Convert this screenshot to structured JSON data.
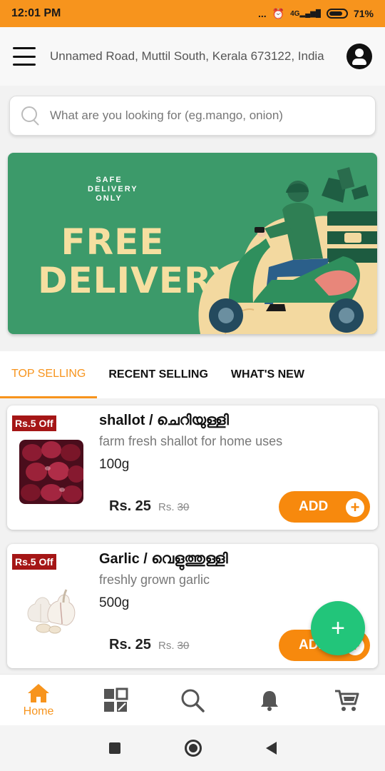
{
  "status_bar": {
    "time": "12:01 PM",
    "dots": "...",
    "network": "4G",
    "battery": "71%"
  },
  "header": {
    "address": "Unnamed Road, Muttil South, Kerala 673122, India"
  },
  "search": {
    "placeholder": "What are you looking for (eg.mango, onion)"
  },
  "banner": {
    "tagline_1": "SAFE",
    "tagline_2": "DELIVERY",
    "tagline_3": "ONLY",
    "headline_1": "FREE",
    "headline_2": "DELIVERY"
  },
  "tabs": [
    {
      "label": "TOP SELLING",
      "active": true
    },
    {
      "label": "RECENT SELLING",
      "active": false
    },
    {
      "label": "WHAT'S NEW",
      "active": false
    }
  ],
  "products": [
    {
      "badge": "Rs.5 Off",
      "name": "shallot  / ചെറിയുള്ളി",
      "description": "farm fresh shallot for home uses",
      "quantity": "100g",
      "price": "Rs. 25",
      "mrp_label": "Rs.",
      "mrp_value": "30",
      "add_label": "ADD"
    },
    {
      "badge": "Rs.5 Off",
      "name": "Garlic  / വെളുത്തുള്ളി",
      "description": "freshly grown garlic",
      "quantity": "500g",
      "price": "Rs. 25",
      "mrp_label": "Rs.",
      "mrp_value": "30",
      "add_label": "ADD"
    }
  ],
  "fab": {
    "label": "+"
  },
  "bottom_nav": {
    "home_label": "Home"
  },
  "colors": {
    "accent": "#f7941d",
    "banner_green": "#3c9a6a",
    "badge_red": "#a51616",
    "fab_green": "#22c57a"
  }
}
